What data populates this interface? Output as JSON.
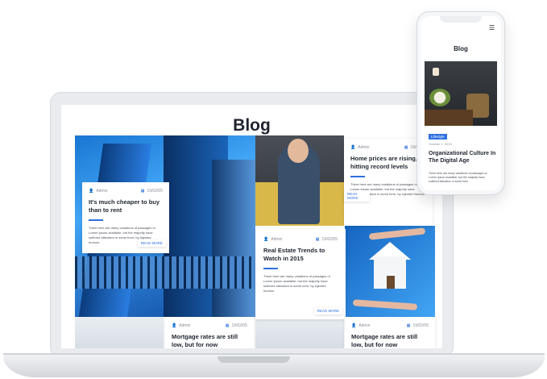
{
  "laptop": {
    "blog_title": "Blog",
    "cards": {
      "cheap": {
        "author": "Admin",
        "date": "19/02/05",
        "title": "It's much cheaper to buy than to rent",
        "excerpt": "There here are many variations of passages of Lorem Ipsum available, but the majority have suffered alteration in some form, by injected humour",
        "read_more": "READ MORE"
      },
      "prices": {
        "author": "Admin",
        "date": "19/02/05",
        "title": "Home prices are rising, hitting record levels",
        "excerpt": "There here are many variations of passages of Lorem Ipsum available, but the majority have suffered alteration in some form, by injected humour",
        "read_more": "READ MORE"
      },
      "trends": {
        "author": "Admin",
        "date": "19/02/05",
        "title": "Real Estate Trends to Watch in 2015",
        "excerpt": "There here are many variations of passages of Lorem Ipsum available, but the majority have suffered alteration in some form, by injected humour",
        "read_more": "READ MORE"
      },
      "mortgage_left": {
        "author": "Admin",
        "date": "19/02/05",
        "title": "Mortgage rates are still low, but for now"
      },
      "mortgage_right": {
        "author": "Admin",
        "date": "19/02/05",
        "title": "Mortgage rates are still low, but for now"
      }
    }
  },
  "phone": {
    "menu_icon": "☰",
    "blog_title": "Blog",
    "badge": "Lifestyle",
    "date": "October 1, 2019",
    "heading": "Organizational Culture In The Digital Age",
    "excerpt": "There here are many variations of passages of Lorem Ipsum available, but the majority have suffered alteration in some form"
  },
  "icons": {
    "author": "person-icon",
    "date": "calendar-icon"
  },
  "colors": {
    "accent": "#2f6fe0",
    "text": "#1f2430"
  }
}
